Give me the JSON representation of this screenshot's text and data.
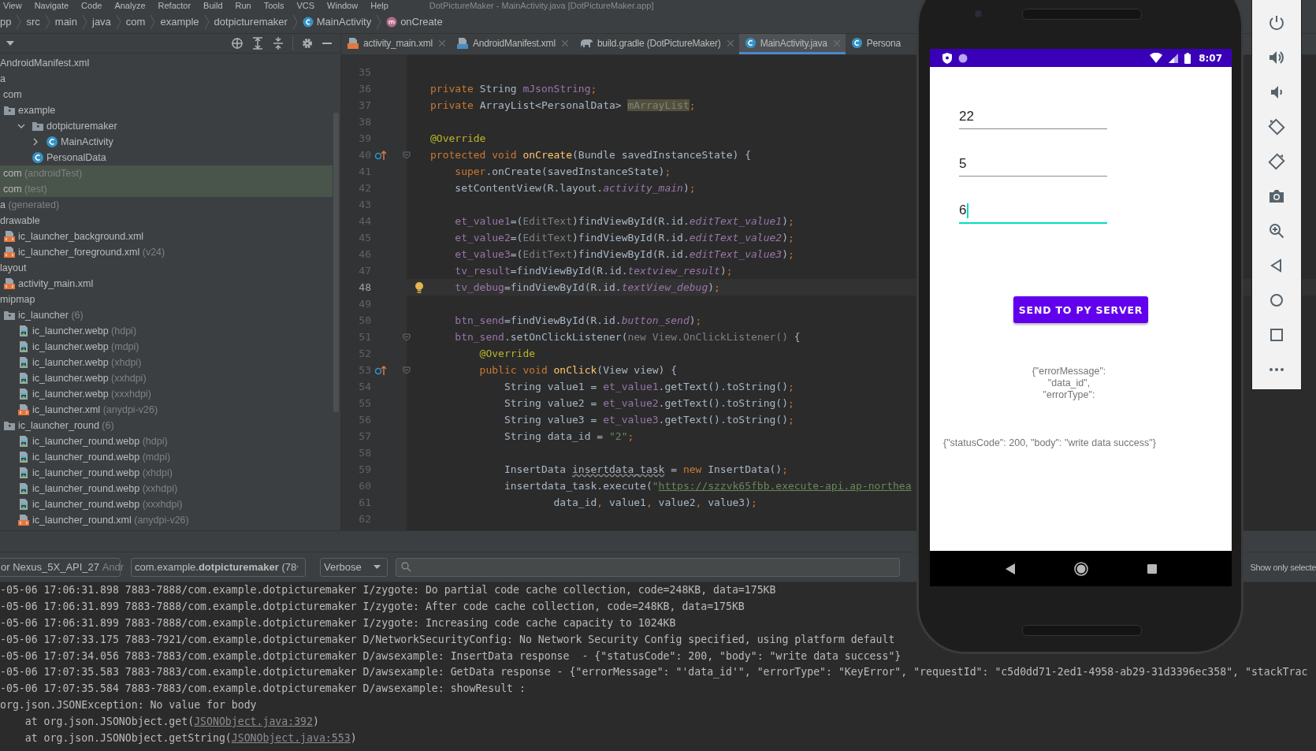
{
  "menu": [
    "View",
    "Navigate",
    "Code",
    "Analyze",
    "Refactor",
    "Build",
    "Run",
    "Tools",
    "VCS",
    "Window",
    "Help"
  ],
  "window": {
    "title": "DotPictureMaker - MainActivity.java [DotPictureMaker.app]"
  },
  "breadcrumb": [
    {
      "label": "pp"
    },
    {
      "label": "src"
    },
    {
      "label": "main"
    },
    {
      "label": "java"
    },
    {
      "label": "com"
    },
    {
      "label": "example"
    },
    {
      "label": "dotpicturemaker"
    },
    {
      "label": "MainActivity",
      "kind": "class"
    },
    {
      "label": "onCreate",
      "kind": "method"
    }
  ],
  "project_tree": [
    {
      "label": "AndroidManifest.xml"
    },
    {
      "label": "a",
      "children": [
        {
          "label": "com"
        },
        {
          "label": "example",
          "kind": "folder",
          "children": [
            {
              "label": "dotpicturemaker",
              "kind": "folder",
              "expanded": true,
              "children": [
                {
                  "label": "MainActivity",
                  "kind": "class",
                  "expanded": false
                },
                {
                  "label": "PersonalData",
                  "kind": "class"
                }
              ]
            }
          ]
        },
        {
          "label": "com",
          "note": "(androidTest)",
          "test_root": true
        },
        {
          "label": "com",
          "note": "(test)",
          "test_root": true
        }
      ]
    },
    {
      "label": "a",
      "note": "(generated)"
    },
    {
      "label": "drawable",
      "children": [
        {
          "label": "ic_launcher_background.xml",
          "kind": "xml"
        },
        {
          "label": "ic_launcher_foreground.xml",
          "kind": "xml",
          "note": "(v24)"
        }
      ]
    },
    {
      "label": "layout",
      "children": [
        {
          "label": "activity_main.xml",
          "kind": "xml"
        }
      ]
    },
    {
      "label": "mipmap",
      "children": [
        {
          "label": "ic_launcher",
          "kind": "folder",
          "note": "(6)",
          "children": [
            {
              "label": "ic_launcher.webp",
              "kind": "image",
              "note": "(hdpi)"
            },
            {
              "label": "ic_launcher.webp",
              "kind": "image",
              "note": "(mdpi)"
            },
            {
              "label": "ic_launcher.webp",
              "kind": "image",
              "note": "(xhdpi)"
            },
            {
              "label": "ic_launcher.webp",
              "kind": "image",
              "note": "(xxhdpi)"
            },
            {
              "label": "ic_launcher.webp",
              "kind": "image",
              "note": "(xxxhdpi)"
            },
            {
              "label": "ic_launcher.xml",
              "kind": "xml",
              "note": "(anydpi-v26)"
            }
          ]
        },
        {
          "label": "ic_launcher_round",
          "kind": "folder",
          "note": "(6)",
          "children": [
            {
              "label": "ic_launcher_round.webp",
              "kind": "image",
              "note": "(hdpi)"
            },
            {
              "label": "ic_launcher_round.webp",
              "kind": "image",
              "note": "(mdpi)"
            },
            {
              "label": "ic_launcher_round.webp",
              "kind": "image",
              "note": "(xhdpi)"
            },
            {
              "label": "ic_launcher_round.webp",
              "kind": "image",
              "note": "(xxhdpi)"
            },
            {
              "label": "ic_launcher_round.webp",
              "kind": "image",
              "note": "(xxxhdpi)"
            },
            {
              "label": "ic_launcher_round.xml",
              "kind": "xml",
              "note": "(anydpi-v26)"
            }
          ]
        }
      ]
    }
  ],
  "editor": {
    "tabs": [
      {
        "label": "activity_main.xml",
        "kind": "xml",
        "selected": false
      },
      {
        "label": "AndroidManifest.xml",
        "kind": "manifest",
        "selected": false
      },
      {
        "label": "build.gradle (DotPictureMaker)",
        "kind": "gradle",
        "selected": false
      },
      {
        "label": "MainActivity.java",
        "kind": "class",
        "selected": true
      },
      {
        "label": "Persona",
        "kind": "class",
        "selected": false
      }
    ],
    "lines": [
      {
        "number": "35"
      },
      {
        "number": "36",
        "tokens": [
          {
            "kind": "kw",
            "text": "private "
          },
          {
            "kind": "plain",
            "text": "String "
          },
          {
            "kind": "field",
            "text": "mJsonString"
          },
          {
            "kind": "kw",
            "text": ";"
          }
        ]
      },
      {
        "number": "37",
        "tokens": [
          {
            "kind": "kw",
            "text": "private "
          },
          {
            "kind": "plain",
            "text": "ArrayList<PersonalData> "
          },
          {
            "kind": "unused",
            "text": "mArrayList"
          },
          {
            "kind": "kw",
            "text": ";"
          }
        ]
      },
      {
        "number": "38"
      },
      {
        "number": "39",
        "tokens": [
          {
            "kind": "annotation",
            "text": "@Override"
          }
        ]
      },
      {
        "number": "40",
        "override": true,
        "fold": true,
        "tokens": [
          {
            "kind": "kw",
            "text": "protected void "
          },
          {
            "kind": "method",
            "text": "onCreate"
          },
          {
            "kind": "plain",
            "text": "(Bundle savedInstanceState) {"
          }
        ]
      },
      {
        "number": "41",
        "tokens": [
          {
            "kind": "kw",
            "text": "    super"
          },
          {
            "kind": "plain",
            "text": ".onCreate(savedInstanceState)"
          },
          {
            "kind": "kw",
            "text": ";"
          }
        ]
      },
      {
        "number": "42",
        "tokens": [
          {
            "kind": "plain",
            "text": "    setContentView(R.layout."
          },
          {
            "kind": "static",
            "text": "activity_main"
          },
          {
            "kind": "plain",
            "text": ")"
          },
          {
            "kind": "kw",
            "text": ";"
          }
        ]
      },
      {
        "number": "43"
      },
      {
        "number": "44",
        "tokens": [
          {
            "kind": "field",
            "text": "    et_value1"
          },
          {
            "kind": "plain",
            "text": "=("
          },
          {
            "kind": "gray",
            "text": "EditText"
          },
          {
            "kind": "plain",
            "text": ")findViewById(R.id."
          },
          {
            "kind": "static",
            "text": "editText_value1"
          },
          {
            "kind": "plain",
            "text": ")"
          },
          {
            "kind": "kw",
            "text": ";"
          }
        ]
      },
      {
        "number": "45",
        "tokens": [
          {
            "kind": "field",
            "text": "    et_value2"
          },
          {
            "kind": "plain",
            "text": "=("
          },
          {
            "kind": "gray",
            "text": "EditText"
          },
          {
            "kind": "plain",
            "text": ")findViewById(R.id."
          },
          {
            "kind": "static",
            "text": "editText_value2"
          },
          {
            "kind": "plain",
            "text": ")"
          },
          {
            "kind": "kw",
            "text": ";"
          }
        ]
      },
      {
        "number": "46",
        "tokens": [
          {
            "kind": "field",
            "text": "    et_value3"
          },
          {
            "kind": "plain",
            "text": "=("
          },
          {
            "kind": "gray",
            "text": "EditText"
          },
          {
            "kind": "plain",
            "text": ")findViewById(R.id."
          },
          {
            "kind": "static",
            "text": "editText_value3"
          },
          {
            "kind": "plain",
            "text": ")"
          },
          {
            "kind": "kw",
            "text": ";"
          }
        ]
      },
      {
        "number": "47",
        "tokens": [
          {
            "kind": "field",
            "text": "    tv_result"
          },
          {
            "kind": "plain",
            "text": "=findViewById(R.id."
          },
          {
            "kind": "static",
            "text": "textview_result"
          },
          {
            "kind": "plain",
            "text": ")"
          },
          {
            "kind": "kw",
            "text": ";"
          }
        ]
      },
      {
        "number": "48",
        "current": true,
        "hint": true,
        "tokens": [
          {
            "kind": "field",
            "text": "    tv_debug"
          },
          {
            "kind": "plain",
            "text": "=findViewById(R.id."
          },
          {
            "kind": "static",
            "text": "textView_debug"
          },
          {
            "kind": "plain",
            "text": ")"
          },
          {
            "kind": "kw",
            "text": ";"
          }
        ]
      },
      {
        "number": "49"
      },
      {
        "number": "50",
        "tokens": [
          {
            "kind": "field",
            "text": "    btn_send"
          },
          {
            "kind": "plain",
            "text": "=findViewById(R.id."
          },
          {
            "kind": "static",
            "text": "button_send"
          },
          {
            "kind": "plain",
            "text": ")"
          },
          {
            "kind": "kw",
            "text": ";"
          }
        ]
      },
      {
        "number": "51",
        "fold": true,
        "tokens": [
          {
            "kind": "field",
            "text": "    btn_send"
          },
          {
            "kind": "plain",
            "text": ".setOnClickListener("
          },
          {
            "kind": "gray",
            "text": "new View.OnClickListener()"
          },
          {
            "kind": "plain",
            "text": " {"
          }
        ]
      },
      {
        "number": "52",
        "tokens": [
          {
            "kind": "annotation",
            "text": "        @Override"
          }
        ]
      },
      {
        "number": "53",
        "override": true,
        "fold": true,
        "tokens": [
          {
            "kind": "kw",
            "text": "        public void "
          },
          {
            "kind": "method",
            "text": "onClick"
          },
          {
            "kind": "plain",
            "text": "(View view) {"
          }
        ]
      },
      {
        "number": "54",
        "tokens": [
          {
            "kind": "plain",
            "text": "            String value1 = "
          },
          {
            "kind": "field",
            "text": "et_value1"
          },
          {
            "kind": "plain",
            "text": ".getText().toString()"
          },
          {
            "kind": "kw",
            "text": ";"
          }
        ]
      },
      {
        "number": "55",
        "tokens": [
          {
            "kind": "plain",
            "text": "            String value2 = "
          },
          {
            "kind": "field",
            "text": "et_value2"
          },
          {
            "kind": "plain",
            "text": ".getText().toString()"
          },
          {
            "kind": "kw",
            "text": ";"
          }
        ]
      },
      {
        "number": "56",
        "tokens": [
          {
            "kind": "plain",
            "text": "            String value3 = "
          },
          {
            "kind": "field",
            "text": "et_value3"
          },
          {
            "kind": "plain",
            "text": ".getText().toString()"
          },
          {
            "kind": "kw",
            "text": ";"
          }
        ]
      },
      {
        "number": "57",
        "tokens": [
          {
            "kind": "plain",
            "text": "            String data_id = "
          },
          {
            "kind": "string",
            "text": "\"2\""
          },
          {
            "kind": "kw",
            "text": ";"
          }
        ]
      },
      {
        "number": "58"
      },
      {
        "number": "59",
        "tokens": [
          {
            "kind": "plain",
            "text": "            InsertData "
          },
          {
            "kind": "warn",
            "text": "insertdata_task"
          },
          {
            "kind": "plain",
            "text": " = "
          },
          {
            "kind": "kw",
            "text": "new "
          },
          {
            "kind": "plain",
            "text": "InsertData()"
          },
          {
            "kind": "kw",
            "text": ";"
          }
        ]
      },
      {
        "number": "60",
        "tokens": [
          {
            "kind": "plain",
            "text": "            insertdata_task.execute("
          },
          {
            "kind": "string",
            "text": "\""
          },
          {
            "kind": "link",
            "text": "https://szzvk65fbb.execute-api.ap-northea"
          }
        ]
      },
      {
        "number": "61",
        "tokens": [
          {
            "kind": "plain",
            "text": "                    data_id"
          },
          {
            "kind": "kw",
            "text": ", "
          },
          {
            "kind": "plain",
            "text": "value1"
          },
          {
            "kind": "kw",
            "text": ", "
          },
          {
            "kind": "plain",
            "text": "value2"
          },
          {
            "kind": "kw",
            "text": ", "
          },
          {
            "kind": "plain",
            "text": "value3)"
          },
          {
            "kind": "kw",
            "text": ";"
          }
        ]
      },
      {
        "number": "62"
      }
    ]
  },
  "logcat": {
    "device": {
      "name": "or Nexus_5X_API_27",
      "detail": "Andr"
    },
    "process": "com.example.**dotpicturemaker** (78",
    "log_level": "Verbose",
    "filter_option": "Show only selecte",
    "lines": [
      {
        "text": "-05-06 17:06:31.898 7883-7888/com.example.dotpicturemaker I/zygote: Do partial code cache collection, code=248KB, data=175KB"
      },
      {
        "text": "-05-06 17:06:31.899 7883-7888/com.example.dotpicturemaker I/zygote: After code cache collection, code=248KB, data=175KB"
      },
      {
        "text": "-05-06 17:06:31.899 7883-7888/com.example.dotpicturemaker I/zygote: Increasing code cache capacity to 1024KB"
      },
      {
        "text": "-05-06 17:07:33.175 7883-7921/com.example.dotpicturemaker D/NetworkSecurityConfig: No Network Security Config specified, using platform default"
      },
      {
        "text": "-05-06 17:07:34.056 7883-7883/com.example.dotpicturemaker D/awsexample: InsertData response  - {\"statusCode\": 200, \"body\": \"write data success\"}"
      },
      {
        "text": "-05-06 17:07:35.583 7883-7883/com.example.dotpicturemaker D/awsexample: GetData response - {\"errorMessage\": \"'data_id'\", \"errorType\": \"KeyError\", \"requestId\": \"c5d0dd71-2ed1-4958-ab29-31d3396ec358\", \"stackTrac"
      },
      {
        "text": "-05-06 17:07:35.584 7883-7883/com.example.dotpicturemaker D/awsexample: showResult :"
      },
      {
        "text": "org.json.JSONException: No value for body"
      },
      {
        "text": "    at org.json.JSONObject.get(",
        "link": "JSONObject.java:392",
        "tail": ")"
      },
      {
        "text": "    at org.json.JSONObject.getString(",
        "link": "JSONObject.java:553",
        "tail": ")"
      }
    ]
  },
  "phone": {
    "status_time": "8:07",
    "fields": [
      {
        "value": "22",
        "focused": false
      },
      {
        "value": "5",
        "focused": false
      },
      {
        "value": "6",
        "focused": true
      }
    ],
    "button": "SEND TO PY SERVER",
    "debug_lines": [
      "{\"errorMessage\":",
      "\"data_id\",",
      "\"errorType\":"
    ],
    "result": "{\"statusCode\": 200, \"body\": \"write data success\"}"
  }
}
